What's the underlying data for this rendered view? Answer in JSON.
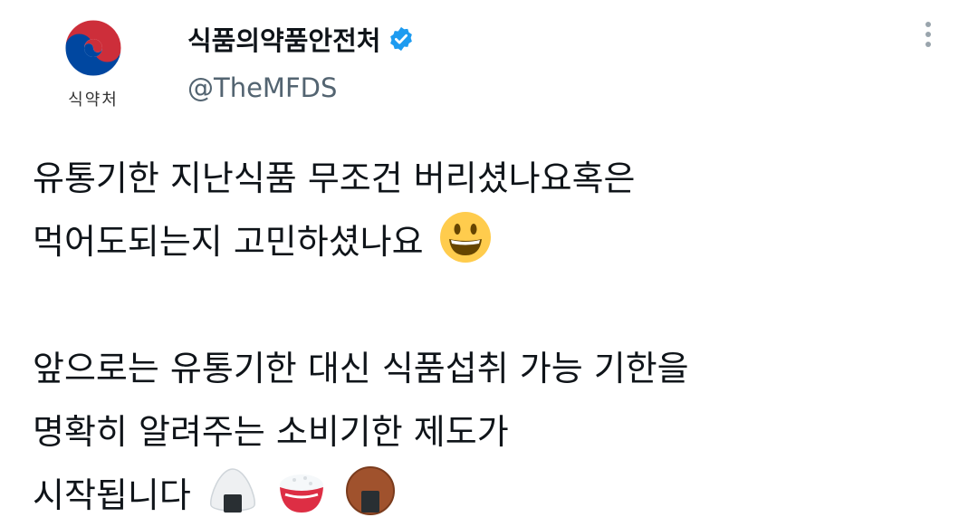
{
  "profile": {
    "avatar_label": "식약처",
    "display_name": "식품의약품안전처",
    "handle": "@TheMFDS",
    "verified_icon": "verified-badge-icon"
  },
  "more_icon": "more-vertical-icon",
  "tweet": {
    "lines": [
      "유통기한 지난식품 무조건 버리셨나요혹은",
      "먹어도되는지 고민하셨나요",
      "",
      "앞으로는 유통기한 대신 식품섭취 가능 기한을",
      "명확히 알려주는 소비기한 제도가",
      "시작됩니다"
    ],
    "emojis": [
      "smiling-face-emoji",
      "rice-ball-emoji",
      "cooked-rice-emoji",
      "rice-cracker-emoji"
    ]
  },
  "colors": {
    "text": "#0f1419",
    "secondary_text": "#536471",
    "verified_blue": "#1d9bf0",
    "emblem_red": "#cd2e3a",
    "emblem_blue": "#0047a0"
  }
}
